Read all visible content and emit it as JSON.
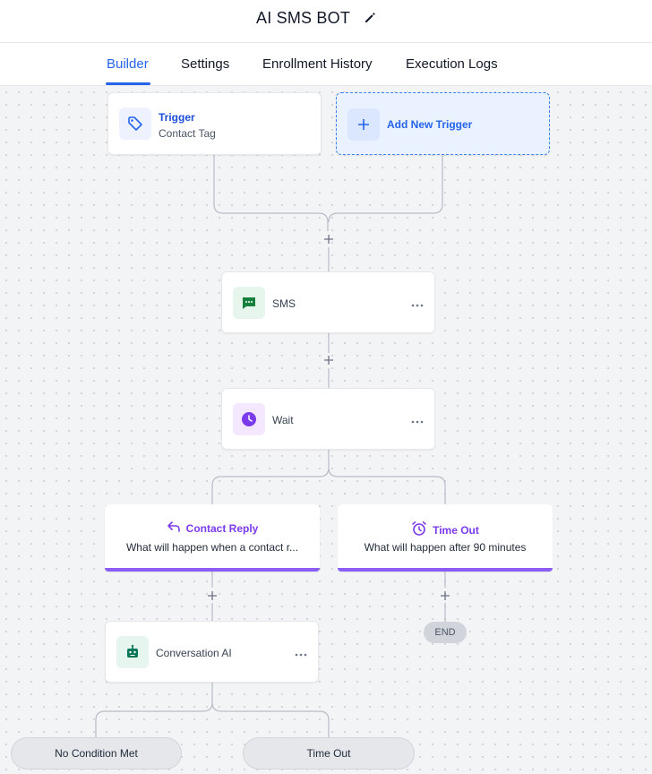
{
  "app": {
    "title": "AI SMS BOT"
  },
  "tabs": [
    {
      "label": "Builder",
      "active": true
    },
    {
      "label": "Settings"
    },
    {
      "label": "Enrollment History"
    },
    {
      "label": "Execution Logs"
    }
  ],
  "trigger": {
    "title": "Trigger",
    "subtitle": "Contact Tag"
  },
  "add_trigger": {
    "label": "Add New Trigger"
  },
  "actions": {
    "sms": {
      "label": "SMS"
    },
    "wait": {
      "label": "Wait"
    },
    "conversation_ai": {
      "label": "Conversation AI"
    }
  },
  "branches": {
    "contact_reply": {
      "title": "Contact Reply",
      "description": "What will happen when a contact r..."
    },
    "time_out": {
      "title": "Time Out",
      "description": "What will happen after 90 minutes"
    }
  },
  "end_label": "END",
  "ai_branches": {
    "no_condition": "No Condition Met",
    "time_out": "Time Out"
  },
  "colors": {
    "accent": "#2563eb",
    "branch_purple": "#8b5cf6",
    "sms_green": "#15803d",
    "wait_purple": "#7c3aed",
    "ai_green": "#047857"
  }
}
